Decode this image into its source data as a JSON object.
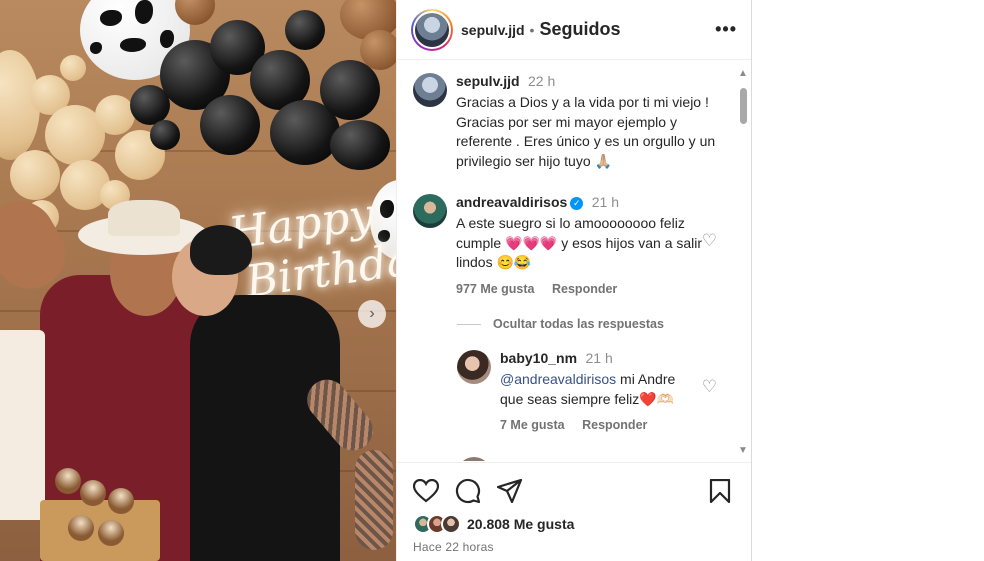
{
  "header": {
    "username": "sepulv.jjd",
    "separator": "•",
    "follow_status": "Seguidos",
    "more_icon": "more-horizontal-icon"
  },
  "photo": {
    "neon_line1": "Happy",
    "neon_line2": "Birthday",
    "next_icon": "chevron-right-icon"
  },
  "caption": {
    "username": "sepulv.jjd",
    "time": "22 h",
    "text": "Gracias a Dios y a la vida por ti mi viejo ! Gracias por  ser mi mayor ejemplo y referente . Eres único y es un orgullo y un privilegio ser hijo tuyo 🙏🏼"
  },
  "comments": [
    {
      "username": "andreavaldirisos",
      "verified": true,
      "time": "21 h",
      "text_part1": "A este suegro si lo amoooooooo feliz cumple ",
      "hearts": "💗💗💗",
      "text_part2": " y esos hijos van a salir lindos 😊😂",
      "likes": "977 Me gusta",
      "reply": "Responder"
    }
  ],
  "hide_replies": "Ocultar todas las respuestas",
  "replies": [
    {
      "username": "baby10_nm",
      "time": "21 h",
      "mention": "@andreavaldirisos",
      "text": " mi Andre que seas siempre feliz❤️🫶🏻",
      "likes": "7 Me gusta",
      "reply": "Responder"
    }
  ],
  "footer": {
    "likes": "20.808 Me gusta",
    "posted": "Hace 22 horas"
  },
  "icons": {
    "like": "heart-icon",
    "comment": "comment-icon",
    "share": "share-icon",
    "save": "bookmark-icon"
  },
  "colors": {
    "link": "#385185",
    "verified": "#0095f6",
    "muted": "#737373"
  }
}
